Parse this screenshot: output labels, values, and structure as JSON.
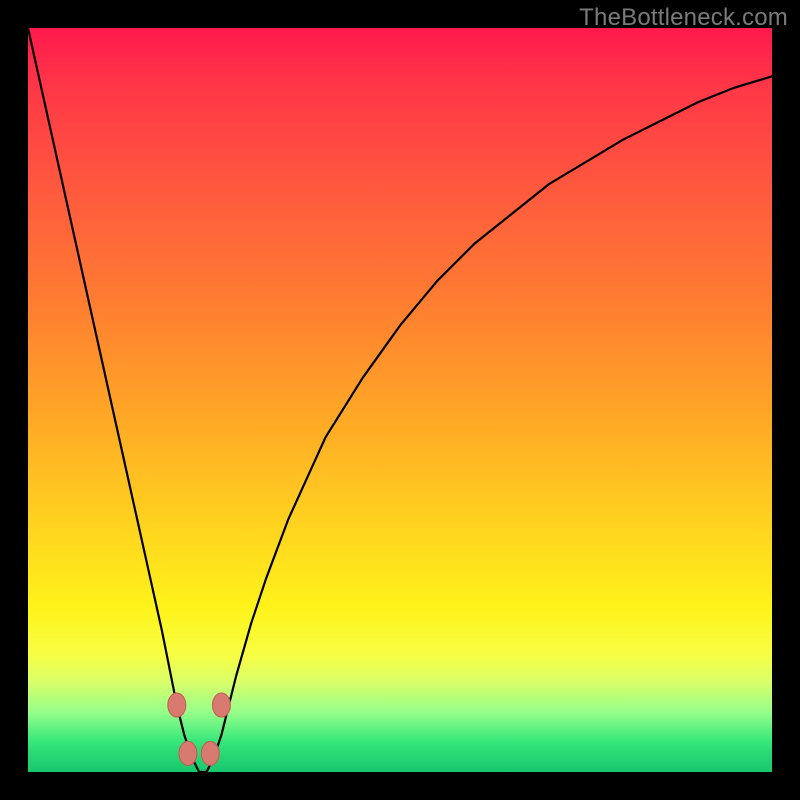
{
  "watermark": {
    "text": "TheBottleneck.com"
  },
  "colors": {
    "frame": "#000000",
    "curve": "#000000",
    "marker_fill": "#d87a6f",
    "marker_stroke": "#c45a50",
    "gradient_stops": [
      "#ff1a4d",
      "#ff3747",
      "#ff5a3e",
      "#ff8030",
      "#ffa726",
      "#ffd11f",
      "#fff31a",
      "#f6ff45",
      "#d7ff6b",
      "#95ff8a",
      "#34e67a",
      "#18c76d"
    ]
  },
  "chart_data": {
    "type": "line",
    "title": "",
    "xlabel": "",
    "ylabel": "",
    "xlim": [
      0,
      100
    ],
    "ylim": [
      0,
      100
    ],
    "grid": false,
    "x": [
      0,
      2,
      4,
      6,
      8,
      10,
      12,
      14,
      16,
      18,
      19,
      20,
      21,
      22,
      23,
      24,
      25,
      26,
      27,
      28,
      30,
      32,
      35,
      40,
      45,
      50,
      55,
      60,
      65,
      70,
      75,
      80,
      85,
      90,
      95,
      100
    ],
    "series": [
      {
        "name": "bottleneck-curve",
        "values": [
          100,
          91,
          82,
          73,
          64,
          55,
          46,
          37,
          28,
          19,
          14,
          9,
          5,
          2,
          0,
          0,
          2,
          5,
          9,
          13,
          20,
          26,
          34,
          45,
          53,
          60,
          66,
          71,
          75,
          79,
          82,
          85,
          87.5,
          90,
          92,
          93.5
        ]
      }
    ],
    "markers": {
      "name": "highlight-points",
      "points": [
        {
          "x": 20,
          "y": 9
        },
        {
          "x": 21.5,
          "y": 2.5
        },
        {
          "x": 24.5,
          "y": 2.5
        },
        {
          "x": 26,
          "y": 9
        }
      ]
    },
    "annotations": []
  }
}
